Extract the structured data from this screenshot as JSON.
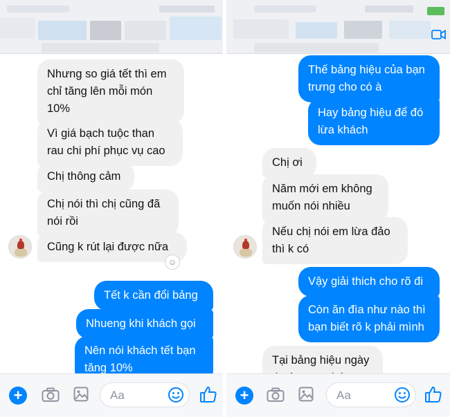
{
  "left_panel": {
    "messages": [
      {
        "type": "received",
        "text": "Nhưng so giá tết thì em\nchỉ tăng lên mỗi món\n10%"
      },
      {
        "type": "received",
        "text": "Vì giá bạch tuộc than\nrau chi phí phục vụ cao"
      },
      {
        "type": "received",
        "text": "Chị thông cảm"
      },
      {
        "type": "received",
        "text": "Chị nói thì chị cũng đã\nnói rồi"
      },
      {
        "type": "received",
        "text": "Cũng k rút lại được nữa"
      },
      {
        "type": "sent",
        "text": "Tết k cần đổi bảng"
      },
      {
        "type": "sent",
        "text": "Nhueng khi khách gọi"
      },
      {
        "type": "sent",
        "text": "Nên nói khách tết bạn\ntăng 10%"
      }
    ]
  },
  "right_panel": {
    "messages": [
      {
        "type": "sent",
        "text": "Thế bảng hiệu của bạn\ntrưng cho có à"
      },
      {
        "type": "sent",
        "text": "Hay bảng hiệu để đó\nlừa khách"
      },
      {
        "type": "received",
        "text": "Chị ơi"
      },
      {
        "type": "received",
        "text": "Năm mới em không\nmuốn nói nhiều"
      },
      {
        "type": "received",
        "text": "Nếu chị nói em lừa đảo\nthì k có"
      },
      {
        "type": "sent",
        "text": "Vậy giải thich cho rõ đi"
      },
      {
        "type": "sent",
        "text": "Còn ăn đìa như nào thì\nbạn biết rõ k phải mình"
      },
      {
        "type": "received",
        "text": "Tại bảng hiệu ngày\nthường em bán"
      }
    ]
  },
  "composer": {
    "placeholder": "Aa",
    "icons": [
      "plus-icon",
      "camera-icon",
      "image-icon",
      "emoji-icon",
      "like-icon"
    ]
  },
  "colors": {
    "sent_bubble": "#0084ff",
    "received_bubble": "#f1f0f0",
    "accent": "#0084ff"
  }
}
